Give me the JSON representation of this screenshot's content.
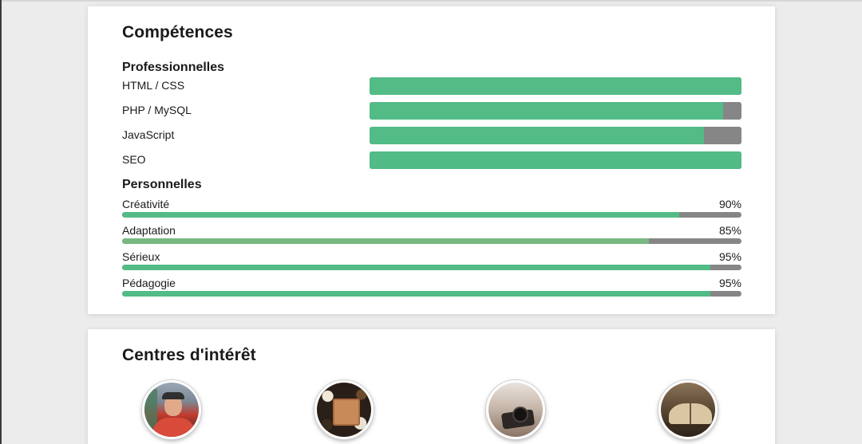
{
  "skills": {
    "title": "Compétences",
    "professional": {
      "title": "Professionnelles",
      "items": [
        {
          "label": "HTML / CSS",
          "level": 100
        },
        {
          "label": "PHP / MySQL",
          "level": 95
        },
        {
          "label": "JavaScript",
          "level": 90
        },
        {
          "label": "SEO",
          "level": 100
        }
      ]
    },
    "personal": {
      "title": "Personnelles",
      "items": [
        {
          "label": "Créativité",
          "percent": "90%",
          "level": 90
        },
        {
          "label": "Adaptation",
          "percent": "85%",
          "level": 85
        },
        {
          "label": "Sérieux",
          "percent": "95%",
          "level": 95
        },
        {
          "label": "Pédagogie",
          "percent": "95%",
          "level": 95
        }
      ]
    }
  },
  "interests": {
    "title": "Centres d'intérêt",
    "items": [
      {
        "icon": "runner-photo"
      },
      {
        "icon": "cooking-photo"
      },
      {
        "icon": "camera-photo"
      },
      {
        "icon": "book-photo"
      }
    ]
  },
  "colors": {
    "bar_fill": "#52bb86",
    "bar_track": "#868686",
    "page_bg": "#ececec"
  }
}
